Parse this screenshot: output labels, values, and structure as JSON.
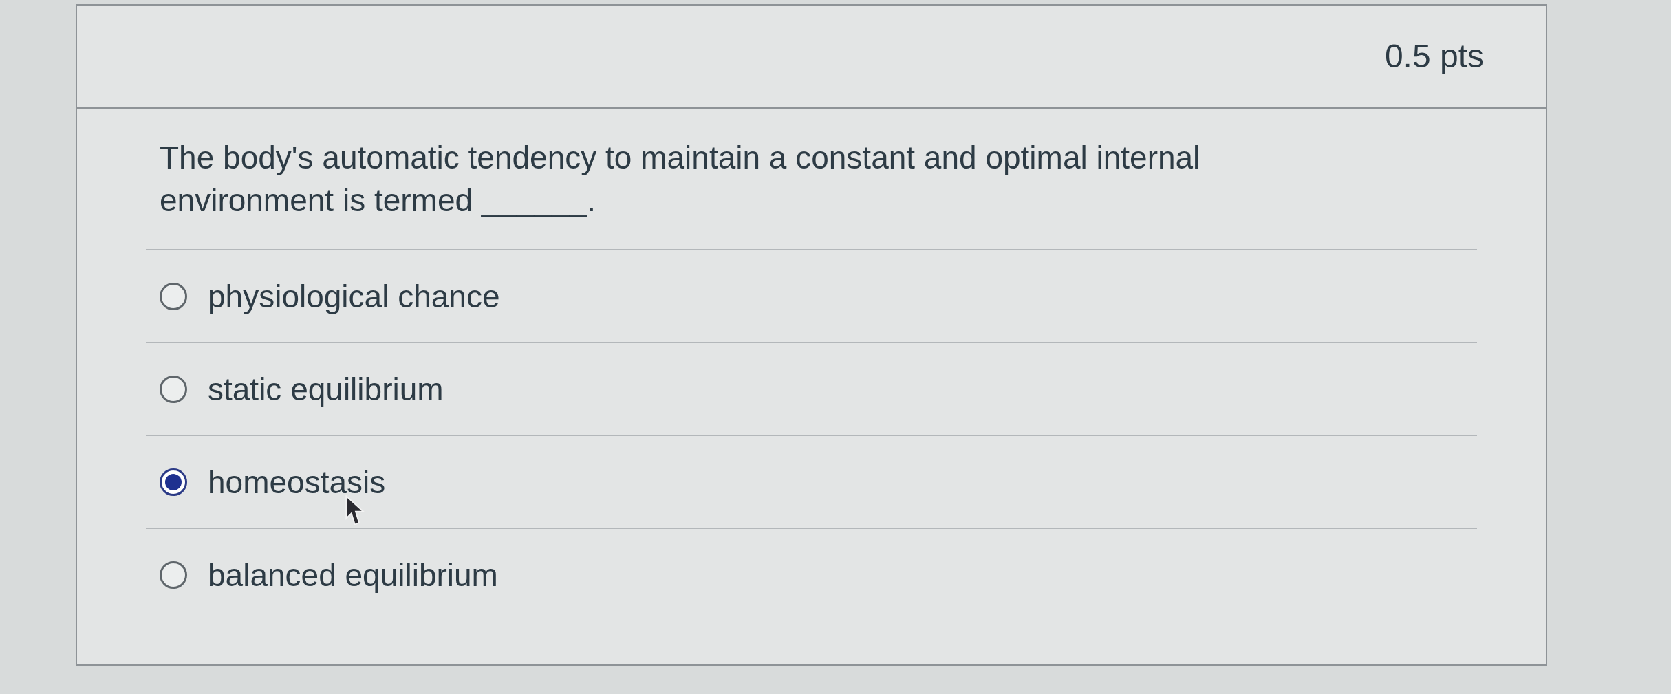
{
  "points": "0.5 pts",
  "question": {
    "text": "The body's automatic tendency to maintain a constant and optimal internal environment is termed ______."
  },
  "options": [
    {
      "label": "physiological chance",
      "selected": false
    },
    {
      "label": "static equilibrium",
      "selected": false
    },
    {
      "label": "homeostasis",
      "selected": true
    },
    {
      "label": "balanced equilibrium",
      "selected": false
    }
  ]
}
